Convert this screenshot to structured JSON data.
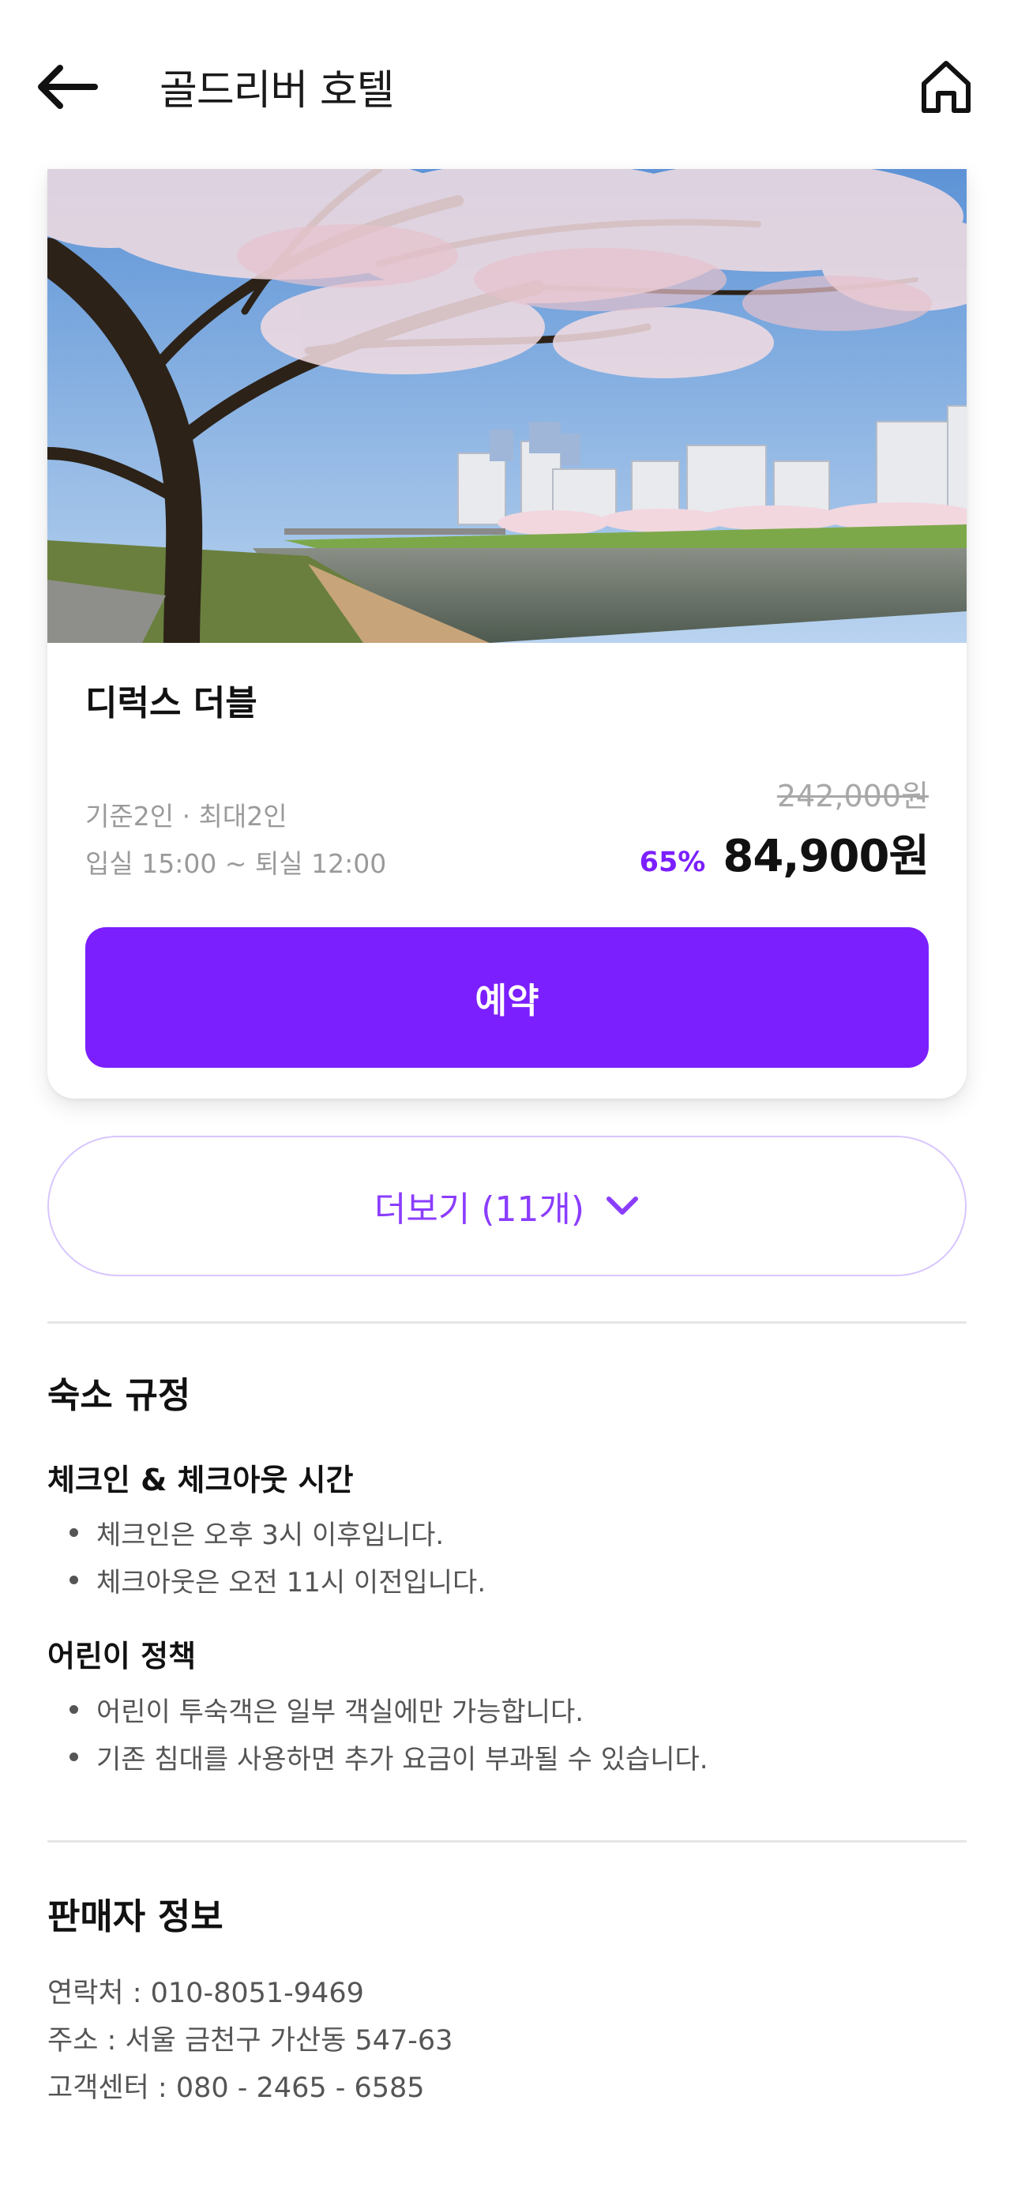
{
  "header": {
    "back_icon": "arrow-left-icon",
    "title": "골드리버 호텔",
    "home_icon": "home-icon"
  },
  "room": {
    "photo_description": "cherry blossom riverside",
    "name": "디럭스 더블",
    "capacity": "기준2인 · 최대2인",
    "checkin_checkout": "입실 15:00 ~ 퇴실 12:00",
    "original_price": "242,000원",
    "discount": "65%",
    "price": "84,900원",
    "reserve_label": "예약"
  },
  "more": {
    "label": "더보기 (11개)",
    "icon": "chevron-down-icon"
  },
  "policy": {
    "title": "숙소 규정",
    "checkin_title": "체크인 & 체크아웃 시간",
    "checkin_items": [
      "체크인은 오후 3시 이후입니다.",
      "체크아웃은 오전 11시 이전입니다."
    ],
    "child_title": "어린이 정책",
    "child_items": [
      "어린이 투숙객은 일부 객실에만 가능합니다.",
      "기존 침대를 사용하면 추가 요금이 부과될 수 있습니다."
    ]
  },
  "seller": {
    "title": "판매자 정보",
    "contact": "연락처 : 010-8051-9469",
    "address": "주소 : 서울 금천구 가산동 547-63",
    "service_center": "고객센터 : 080 - 2465 - 6585"
  },
  "colors": {
    "accent": "#7b1fff",
    "accent_light": "#8b3dff",
    "muted_text": "#9a9a9a",
    "divider": "#e6e6e6"
  }
}
